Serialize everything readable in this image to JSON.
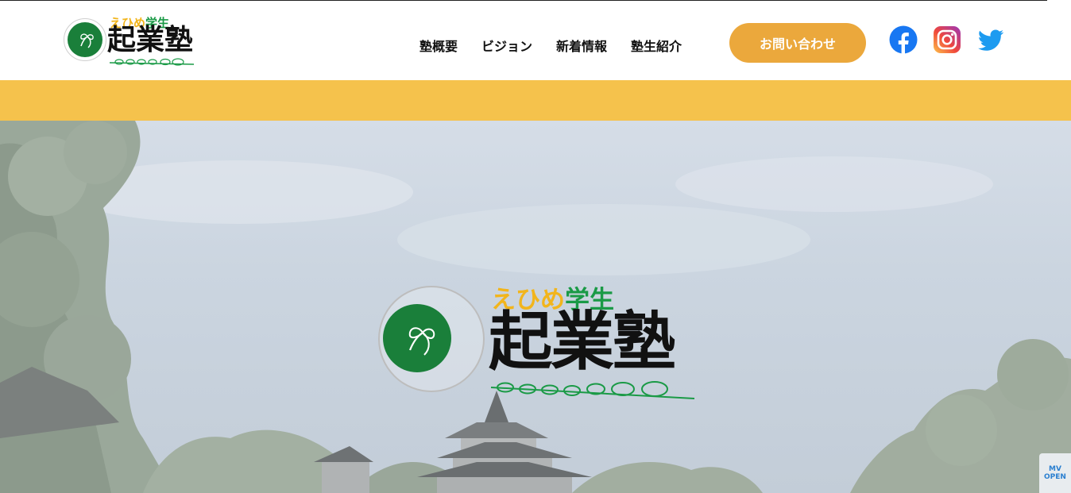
{
  "colors": {
    "accent_orange": "#eba83c",
    "band_yellow": "#f5c24c",
    "brand_green": "#1a7f3a",
    "sub_yellow": "#f2b51c",
    "sub_green": "#1a9a46"
  },
  "logo": {
    "sub_prefix": "えひめ",
    "sub_suffix": "学生",
    "main": "起業塾"
  },
  "nav": {
    "items": [
      {
        "label": "塾概要"
      },
      {
        "label": "ビジョン"
      },
      {
        "label": "新着情報"
      },
      {
        "label": "塾生紹介"
      }
    ],
    "contact_label": "お問い合わせ"
  },
  "social": {
    "facebook": "facebook-icon",
    "instagram": "instagram-icon",
    "twitter": "twitter-icon"
  },
  "hero": {
    "sub_prefix": "えひめ",
    "sub_suffix": "学生",
    "main": "起業塾"
  },
  "badge": {
    "mark": "MV",
    "label": "OPEN"
  }
}
